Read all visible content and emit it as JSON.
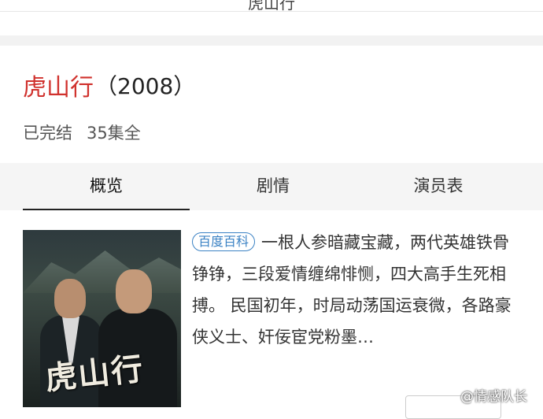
{
  "page": {
    "top_title": "虎山行"
  },
  "header": {
    "title": "虎山行",
    "year": "（2008）",
    "status": "已完结",
    "episodes": "35集全"
  },
  "tabs": [
    {
      "label": "概览",
      "active": true
    },
    {
      "label": "剧情",
      "active": false
    },
    {
      "label": "演员表",
      "active": false
    }
  ],
  "summary": {
    "badge": "百度百科",
    "text": "一根人参暗藏宝藏，两代英雄铁骨铮铮，三段爱情缠绵悱恻，四大高手生死相搏。 民国初年，时局动荡国运衰微，各路豪侠义士、奸佞宦党粉墨…"
  },
  "poster": {
    "calligraphy": "虎山行"
  },
  "watermark": "@情感队长",
  "colors": {
    "title_red": "#d0312d",
    "badge_blue": "#3b82c4",
    "tab_bar_bg": "#f5f5f5"
  }
}
